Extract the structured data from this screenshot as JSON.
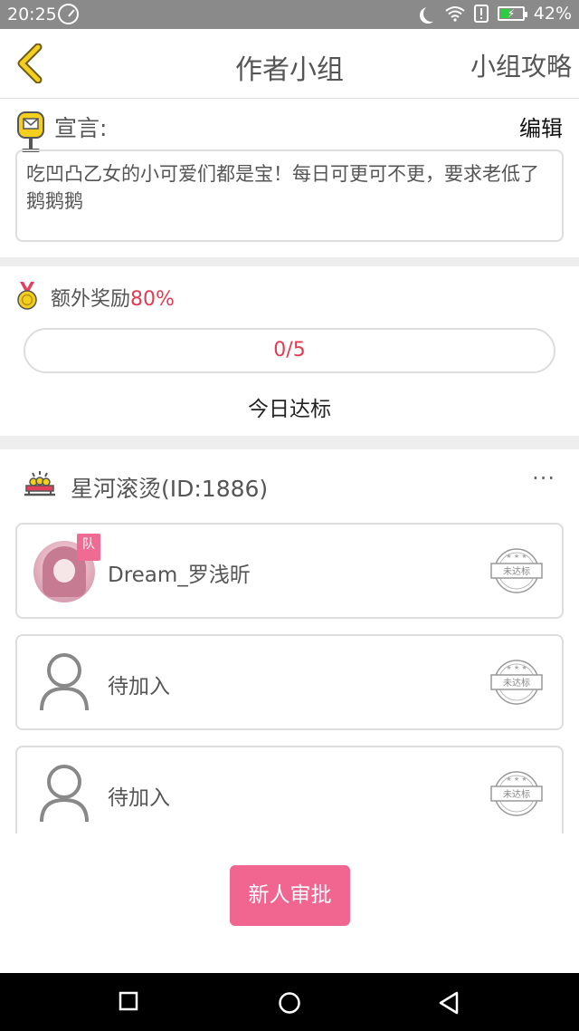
{
  "status_bar": {
    "time": "20:25",
    "battery": "42%",
    "battery_level": 0.42
  },
  "header": {
    "title": "作者小组",
    "guide_link": "小组攻略",
    "back_icon": "chevron-left-icon"
  },
  "declaration": {
    "label": "宣言:",
    "edit_label": "编辑",
    "text": "吃凹凸乙女的小可爱们都是宝！每日可更可不更，要求老低了鹅鹅鹅"
  },
  "bonus": {
    "label": "额外奖励",
    "percent": "80%",
    "progress_text": "0/5",
    "today_label": "今日达标"
  },
  "group": {
    "name": "星河滚烫(ID:1886)",
    "more": "···",
    "members": [
      {
        "name": "Dream_罗浅昕",
        "badge": "队",
        "stamp": "未达标",
        "avatar": "user-avatar"
      },
      {
        "name": "待加入",
        "stamp": "未达标",
        "avatar": "person-icon"
      },
      {
        "name": "待加入",
        "stamp": "未达标",
        "avatar": "person-icon"
      }
    ]
  },
  "approve_button": "新人审批",
  "colors": {
    "accent": "#f06690",
    "highlight": "#e23b53",
    "header_icon": "#f4cf1d"
  }
}
